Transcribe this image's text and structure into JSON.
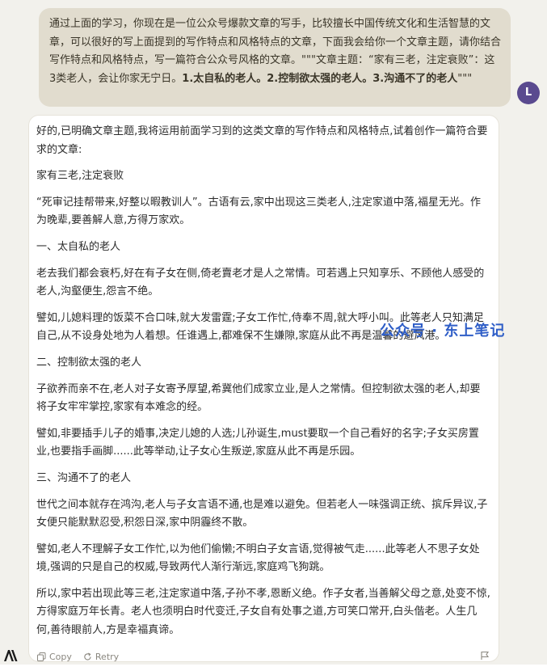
{
  "user_message": {
    "text_plain": "通过上面的学习，你现在是一位公众号爆款文章的写手，比较擅长中国传统文化和生活智慧的文章，可以很好的写上面提到的写作特点和风格特点的文章，下面我会给你一个文章主题，请你结合写作特点和风格特点，写一篇符合公众号风格的文章。\"\"\"文章主题：“家有三老，注定衰败”：这3类老人，会让你家无宁日。",
    "text_bold": "1.太自私的老人。2.控制欲太强的老人。3.沟通不了的老人",
    "text_tail": "\"\"\""
  },
  "avatar": {
    "initial": "L"
  },
  "assistant_message": {
    "paragraphs": [
      "好的,已明确文章主题,我将运用前面学习到的这类文章的写作特点和风格特点,试着创作一篇符合要求的文章:",
      "家有三老,注定衰败",
      "“死审记挂帮带来,好整以暇教训人”。古语有云,家中出现这三类老人,注定家道中落,福星无光。作为晚辈,要善解人意,方得万家欢。",
      "一、太自私的老人",
      "老去我们都会衰朽,好在有子女在侧,倚老賣老才是人之常情。可若遇上只知享乐、不顾他人感受的老人,沟壑便生,怨言不绝。",
      "譬如,儿媳料理的饭菜不合口味,就大发雷霆;子女工作忙,侍奉不周,就大呼小叫。此等老人只知满足自己,从不设身处地为人着想。任谁遇上,都难保不生嫌隙,家庭从此不再是温馨的避风港。",
      "二、控制欲太强的老人",
      "子欲养而亲不在,老人对子女寄予厚望,希冀他们成家立业,是人之常情。但控制欲太强的老人,却要将子女牢牢掌控,家家有本难念的经。",
      "譬如,非要插手儿子的婚事,决定儿媳的人选;儿孙诞生,must要取一个自己看好的名字;子女买房置业,也要指手画脚......此等举动,让子女心生叛逆,家庭从此不再是乐园。",
      "三、沟通不了的老人",
      "世代之间本就存在鸿沟,老人与子女言语不通,也是难以避免。但若老人一味强调正统、摈斥异议,子女便只能默默忍受,积怨日深,家中阴霾终不散。",
      "譬如,老人不理解子女工作忙,以为他们偷懒;不明白子女言语,觉得被气走......此等老人不思子女处境,强调的只是自己的权威,导致两代人渐行渐远,家庭鸡飞狗跳。",
      "所以,家中若出现此等三老,注定家道中落,子孙不孝,恩断义绝。作子女者,当善解父母之意,处变不惊,方得家庭万年长青。老人也须明白时代变迁,子女自有处事之道,方可笑口常开,白头偕老。人生几何,善待眼前人,方是幸福真谛。"
    ]
  },
  "watermark": "公众号 · 东上笔记",
  "actions": {
    "copy_label": "Copy",
    "retry_label": "Retry"
  }
}
